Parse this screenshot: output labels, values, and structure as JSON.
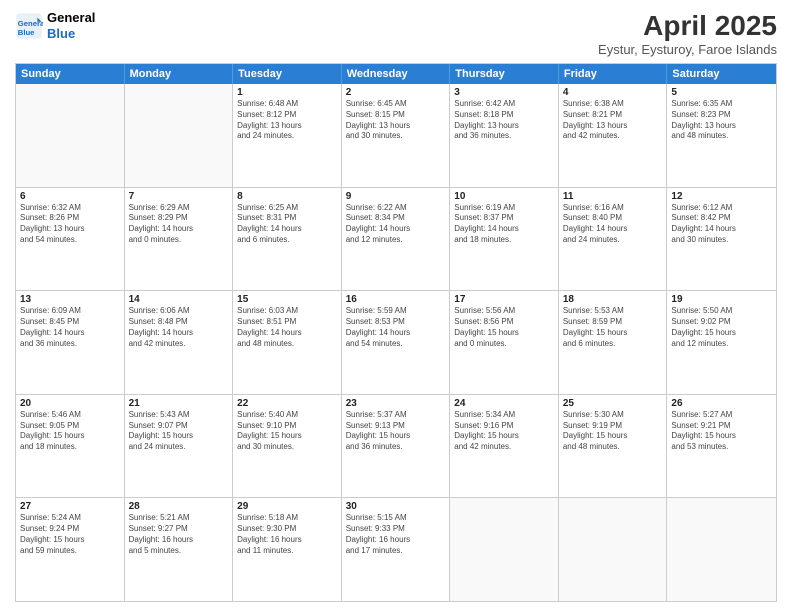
{
  "logo": {
    "line1": "General",
    "line2": "Blue"
  },
  "title": "April 2025",
  "subtitle": "Eystur, Eysturoy, Faroe Islands",
  "days": [
    "Sunday",
    "Monday",
    "Tuesday",
    "Wednesday",
    "Thursday",
    "Friday",
    "Saturday"
  ],
  "rows": [
    [
      {
        "day": null,
        "info": null
      },
      {
        "day": null,
        "info": null
      },
      {
        "day": "1",
        "info": "Sunrise: 6:48 AM\nSunset: 8:12 PM\nDaylight: 13 hours\nand 24 minutes."
      },
      {
        "day": "2",
        "info": "Sunrise: 6:45 AM\nSunset: 8:15 PM\nDaylight: 13 hours\nand 30 minutes."
      },
      {
        "day": "3",
        "info": "Sunrise: 6:42 AM\nSunset: 8:18 PM\nDaylight: 13 hours\nand 36 minutes."
      },
      {
        "day": "4",
        "info": "Sunrise: 6:38 AM\nSunset: 8:21 PM\nDaylight: 13 hours\nand 42 minutes."
      },
      {
        "day": "5",
        "info": "Sunrise: 6:35 AM\nSunset: 8:23 PM\nDaylight: 13 hours\nand 48 minutes."
      }
    ],
    [
      {
        "day": "6",
        "info": "Sunrise: 6:32 AM\nSunset: 8:26 PM\nDaylight: 13 hours\nand 54 minutes."
      },
      {
        "day": "7",
        "info": "Sunrise: 6:29 AM\nSunset: 8:29 PM\nDaylight: 14 hours\nand 0 minutes."
      },
      {
        "day": "8",
        "info": "Sunrise: 6:25 AM\nSunset: 8:31 PM\nDaylight: 14 hours\nand 6 minutes."
      },
      {
        "day": "9",
        "info": "Sunrise: 6:22 AM\nSunset: 8:34 PM\nDaylight: 14 hours\nand 12 minutes."
      },
      {
        "day": "10",
        "info": "Sunrise: 6:19 AM\nSunset: 8:37 PM\nDaylight: 14 hours\nand 18 minutes."
      },
      {
        "day": "11",
        "info": "Sunrise: 6:16 AM\nSunset: 8:40 PM\nDaylight: 14 hours\nand 24 minutes."
      },
      {
        "day": "12",
        "info": "Sunrise: 6:12 AM\nSunset: 8:42 PM\nDaylight: 14 hours\nand 30 minutes."
      }
    ],
    [
      {
        "day": "13",
        "info": "Sunrise: 6:09 AM\nSunset: 8:45 PM\nDaylight: 14 hours\nand 36 minutes."
      },
      {
        "day": "14",
        "info": "Sunrise: 6:06 AM\nSunset: 8:48 PM\nDaylight: 14 hours\nand 42 minutes."
      },
      {
        "day": "15",
        "info": "Sunrise: 6:03 AM\nSunset: 8:51 PM\nDaylight: 14 hours\nand 48 minutes."
      },
      {
        "day": "16",
        "info": "Sunrise: 5:59 AM\nSunset: 8:53 PM\nDaylight: 14 hours\nand 54 minutes."
      },
      {
        "day": "17",
        "info": "Sunrise: 5:56 AM\nSunset: 8:56 PM\nDaylight: 15 hours\nand 0 minutes."
      },
      {
        "day": "18",
        "info": "Sunrise: 5:53 AM\nSunset: 8:59 PM\nDaylight: 15 hours\nand 6 minutes."
      },
      {
        "day": "19",
        "info": "Sunrise: 5:50 AM\nSunset: 9:02 PM\nDaylight: 15 hours\nand 12 minutes."
      }
    ],
    [
      {
        "day": "20",
        "info": "Sunrise: 5:46 AM\nSunset: 9:05 PM\nDaylight: 15 hours\nand 18 minutes."
      },
      {
        "day": "21",
        "info": "Sunrise: 5:43 AM\nSunset: 9:07 PM\nDaylight: 15 hours\nand 24 minutes."
      },
      {
        "day": "22",
        "info": "Sunrise: 5:40 AM\nSunset: 9:10 PM\nDaylight: 15 hours\nand 30 minutes."
      },
      {
        "day": "23",
        "info": "Sunrise: 5:37 AM\nSunset: 9:13 PM\nDaylight: 15 hours\nand 36 minutes."
      },
      {
        "day": "24",
        "info": "Sunrise: 5:34 AM\nSunset: 9:16 PM\nDaylight: 15 hours\nand 42 minutes."
      },
      {
        "day": "25",
        "info": "Sunrise: 5:30 AM\nSunset: 9:19 PM\nDaylight: 15 hours\nand 48 minutes."
      },
      {
        "day": "26",
        "info": "Sunrise: 5:27 AM\nSunset: 9:21 PM\nDaylight: 15 hours\nand 53 minutes."
      }
    ],
    [
      {
        "day": "27",
        "info": "Sunrise: 5:24 AM\nSunset: 9:24 PM\nDaylight: 15 hours\nand 59 minutes."
      },
      {
        "day": "28",
        "info": "Sunrise: 5:21 AM\nSunset: 9:27 PM\nDaylight: 16 hours\nand 5 minutes."
      },
      {
        "day": "29",
        "info": "Sunrise: 5:18 AM\nSunset: 9:30 PM\nDaylight: 16 hours\nand 11 minutes."
      },
      {
        "day": "30",
        "info": "Sunrise: 5:15 AM\nSunset: 9:33 PM\nDaylight: 16 hours\nand 17 minutes."
      },
      {
        "day": null,
        "info": null
      },
      {
        "day": null,
        "info": null
      },
      {
        "day": null,
        "info": null
      }
    ]
  ]
}
